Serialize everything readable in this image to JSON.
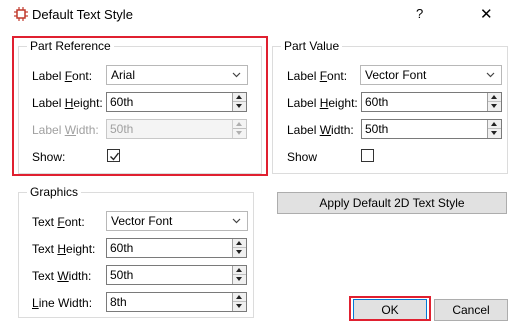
{
  "window": {
    "title": "Default Text Style",
    "help_label": "?",
    "close_label": "✕"
  },
  "part_reference": {
    "title": "Part Reference",
    "label_font": {
      "label_pre": "Label ",
      "label_u": "F",
      "label_post": "ont:",
      "value": "Arial"
    },
    "label_height": {
      "label_pre": "Label ",
      "label_u": "H",
      "label_post": "eight:",
      "value": "60th"
    },
    "label_width": {
      "label_pre": "Label ",
      "label_u": "W",
      "label_post": "idth:",
      "value": "50th"
    },
    "show": {
      "label": "Show:",
      "checked": true
    }
  },
  "part_value": {
    "title": "Part Value",
    "label_font": {
      "label_pre": "Label ",
      "label_u": "F",
      "label_post": "ont:",
      "value": "Vector Font"
    },
    "label_height": {
      "label_pre": "Label ",
      "label_u": "H",
      "label_post": "eight:",
      "value": "60th"
    },
    "label_width": {
      "label_pre": "Label ",
      "label_u": "W",
      "label_post": "idth:",
      "value": "50th"
    },
    "show": {
      "label": "Show",
      "checked": false
    }
  },
  "graphics": {
    "title": "Graphics",
    "text_font": {
      "label_pre": "Text ",
      "label_u": "F",
      "label_post": "ont:",
      "value": "Vector Font"
    },
    "text_height": {
      "label_pre": "Text ",
      "label_u": "H",
      "label_post": "eight:",
      "value": "60th"
    },
    "text_width": {
      "label_pre": "Text ",
      "label_u": "W",
      "label_post": "idth:",
      "value": "50th"
    },
    "line_width": {
      "label_pre": "",
      "label_u": "L",
      "label_post": "ine Width:",
      "value": "8th"
    }
  },
  "buttons": {
    "apply_2d": "Apply Default 2D Text Style",
    "ok": "OK",
    "cancel": "Cancel"
  },
  "colors": {
    "highlight": "#e02030",
    "focus_border": "#0078d7",
    "icon_red": "#c0392b"
  }
}
